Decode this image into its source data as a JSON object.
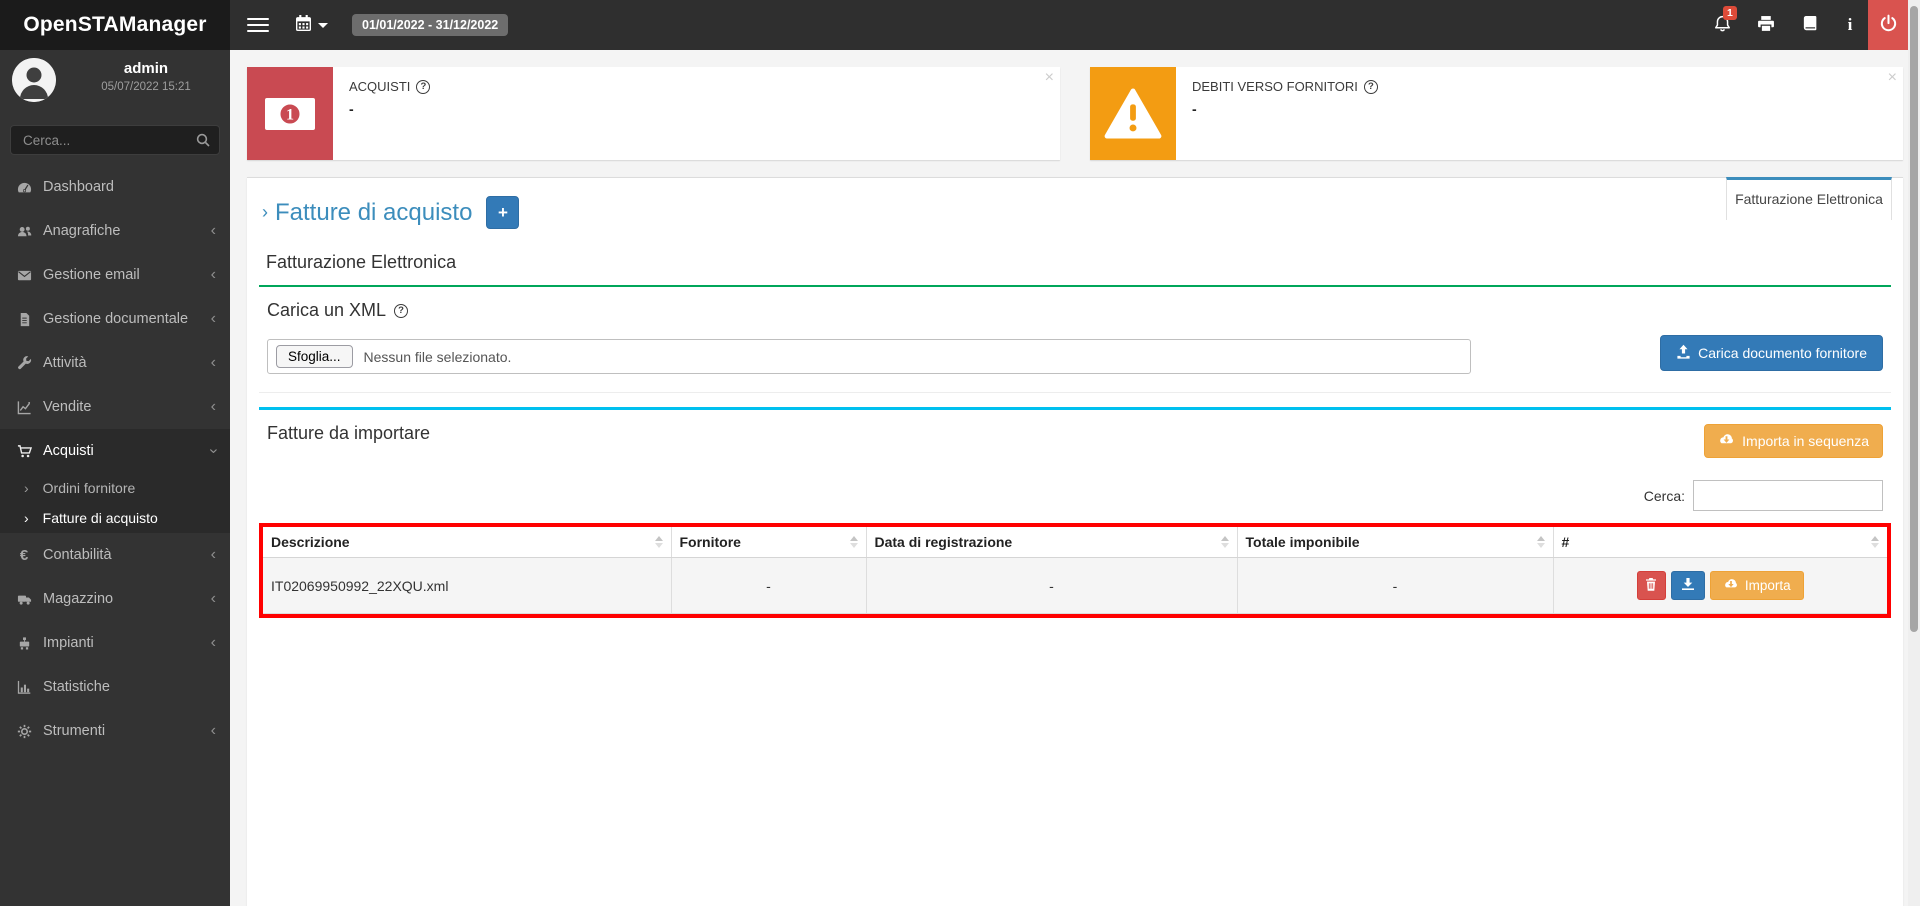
{
  "symbols": {
    "help": "?",
    "close": "×",
    "chevron_left": "‹",
    "chevron_right": "›",
    "info_i": "i"
  },
  "colors": {
    "accent_blue": "#3c8dbc",
    "primary": "#337ab7",
    "success": "#00a65a",
    "info": "#00c0ef",
    "warning": "#f0ad4e",
    "danger": "#d9534f",
    "annotation_red": "#ff0000"
  },
  "navbar": {
    "logo": "OpenSTAManager",
    "date_range": "01/01/2022 - 31/12/2022",
    "notification_count": "1"
  },
  "sidebar": {
    "user": {
      "name": "admin",
      "last_login": "05/07/2022 15:21"
    },
    "search_placeholder": "Cerca...",
    "items": [
      {
        "label": "Dashboard",
        "icon": "dashboard"
      },
      {
        "label": "Anagrafiche",
        "icon": "users"
      },
      {
        "label": "Gestione email",
        "icon": "envelope"
      },
      {
        "label": "Gestione documentale",
        "icon": "document"
      },
      {
        "label": "Attività",
        "icon": "wrench"
      },
      {
        "label": "Vendite",
        "icon": "chart-line"
      },
      {
        "label": "Acquisti",
        "icon": "cart",
        "expanded": true
      },
      {
        "label": "Contabilità",
        "icon": "euro"
      },
      {
        "label": "Magazzino",
        "icon": "truck"
      },
      {
        "label": "Impianti",
        "icon": "machine"
      },
      {
        "label": "Statistiche",
        "icon": "bar-chart"
      },
      {
        "label": "Strumenti",
        "icon": "gear"
      }
    ],
    "acquisti_submenu": [
      {
        "label": "Ordini fornitore",
        "active": false
      },
      {
        "label": "Fatture di acquisto",
        "active": true
      }
    ]
  },
  "infoboxes": [
    {
      "title": "ACQUISTI",
      "value": "-",
      "icon": "money-bill",
      "color": "#c94a52"
    },
    {
      "title": "DEBITI VERSO FORNITORI",
      "value": "-",
      "icon": "warning-triangle",
      "color": "#f39c12"
    }
  ],
  "page": {
    "breadcrumb_arrow": "›",
    "title": "Fatture di acquisto",
    "add_button": "+",
    "tab": "Fatturazione Elettronica",
    "section_heading": "Fatturazione Elettronica"
  },
  "upload": {
    "panel_title": "Carica un XML",
    "browse_button": "Sfoglia...",
    "file_status": "Nessun file selezionato.",
    "upload_button": "Carica documento fornitore"
  },
  "import": {
    "panel_title": "Fatture da importare",
    "sequence_button": "Importa in sequenza",
    "search_label": "Cerca:",
    "search_value": ""
  },
  "table": {
    "headers": [
      "Descrizione",
      "Fornitore",
      "Data di registrazione",
      "Totale imponibile",
      "#"
    ],
    "rows": [
      {
        "descrizione": "IT02069950992_22XQU.xml",
        "fornitore": "-",
        "data_registrazione": "-",
        "totale_imponibile": "-"
      }
    ],
    "row_actions": {
      "import_button": "Importa"
    }
  }
}
